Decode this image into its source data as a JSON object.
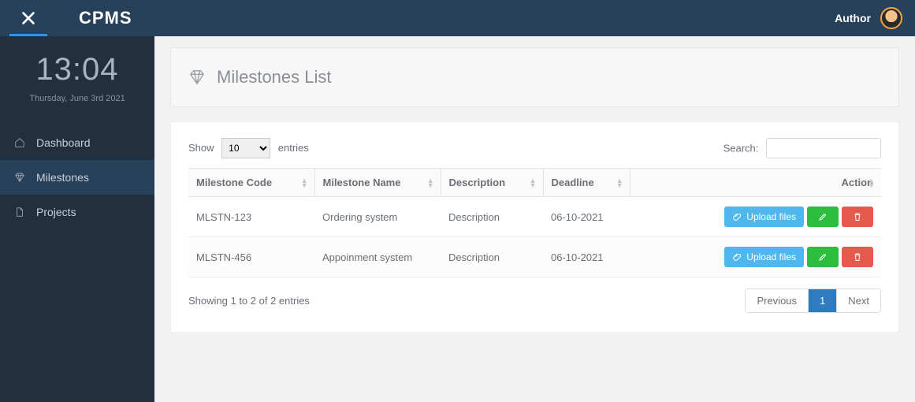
{
  "header": {
    "brand": "CPMS",
    "user_role": "Author"
  },
  "sidebar": {
    "clock": "13:04",
    "date": "Thursday, June 3rd 2021",
    "items": [
      {
        "label": "Dashboard"
      },
      {
        "label": "Milestones"
      },
      {
        "label": "Projects"
      }
    ]
  },
  "page": {
    "title": "Milestones List"
  },
  "table": {
    "show_label_pre": "Show",
    "show_label_post": "entries",
    "page_size": "10",
    "search_label": "Search:",
    "columns": {
      "code": "Milestone Code",
      "name": "Milestone Name",
      "desc": "Description",
      "deadline": "Deadline",
      "action": "Action"
    },
    "rows": [
      {
        "code": "MLSTN-123",
        "name": "Ordering system",
        "desc": "Description",
        "deadline": "06-10-2021"
      },
      {
        "code": "MLSTN-456",
        "name": "Appoinment system",
        "desc": "Description",
        "deadline": "06-10-2021"
      }
    ],
    "upload_label": "Upload files",
    "info": "Showing 1 to 2 of 2 entries",
    "pager": {
      "prev": "Previous",
      "page": "1",
      "next": "Next"
    }
  }
}
